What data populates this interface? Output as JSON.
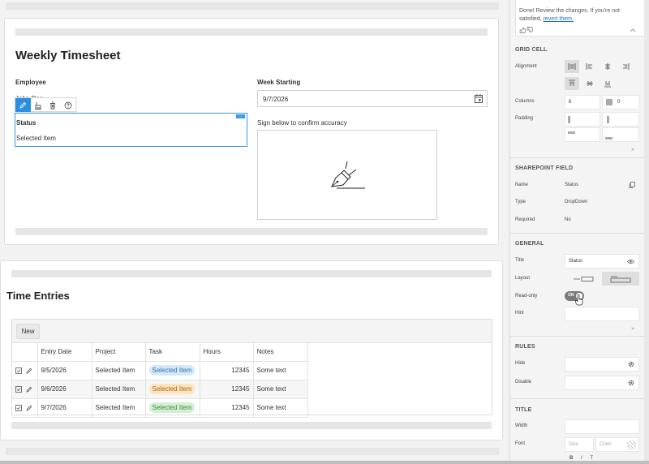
{
  "form": {
    "title": "Weekly Timesheet",
    "employee_label": "Employee",
    "employee_value": "John Doe",
    "week_label": "Week Starting",
    "week_value": "9/7/2026",
    "status_label": "Status",
    "status_value": "Selected Item",
    "signature_label": "Sign below to confirm accuracy"
  },
  "toolbar": {
    "edit_icon": "pencil-icon",
    "style_icon": "format-icon",
    "delete_icon": "trash-icon",
    "help_icon": "help-icon"
  },
  "entries": {
    "title": "Time Entries",
    "new_label": "New",
    "columns": [
      "Entry Date",
      "Project",
      "Task",
      "Hours",
      "Notes"
    ],
    "rows": [
      {
        "date": "9/5/2026",
        "project": "Selected Item",
        "task": "Selected Item",
        "task_color": "#d6e9fb",
        "task_text": "#2b6fb3",
        "hours": "12345",
        "notes": "Some text"
      },
      {
        "date": "9/6/2026",
        "project": "Selected Item",
        "task": "Selected Item",
        "task_color": "#fde4bf",
        "task_text": "#a5651a",
        "hours": "12345",
        "notes": "Some text"
      },
      {
        "date": "9/7/2026",
        "project": "Selected Item",
        "task": "Selected Item",
        "task_color": "#d4efd4",
        "task_text": "#3b8a3b",
        "hours": "12345",
        "notes": "Some text"
      }
    ]
  },
  "panel": {
    "chat_message": "Done! Review the changes. If you're not satisfied,",
    "chat_link": "revert them.",
    "grid_cell": {
      "heading": "GRID CELL",
      "alignment_label": "Alignment",
      "columns_label": "Columns",
      "columns_value": "6",
      "offset_value": "0",
      "padding_label": "Padding"
    },
    "sharepoint": {
      "heading": "SHAREPOINT FIELD",
      "name_label": "Name",
      "name_value": "Status",
      "type_label": "Type",
      "type_value": "DropDown",
      "required_label": "Required",
      "required_value": "No"
    },
    "general": {
      "heading": "GENERAL",
      "title_label": "Title",
      "title_value": "Status",
      "layout_label": "Layout",
      "readonly_label": "Read-only",
      "readonly_value": "ON",
      "hint_label": "Hint"
    },
    "rules": {
      "heading": "RULES",
      "hide_label": "Hide",
      "disable_label": "Disable"
    },
    "title_section": {
      "heading": "TITLE",
      "width_label": "Width",
      "font_label": "Font",
      "size_placeholder": "Size",
      "color_placeholder": "Color"
    }
  },
  "colors": {
    "accent": "#2b8ee0",
    "selection_border": "#3a9ae0"
  }
}
